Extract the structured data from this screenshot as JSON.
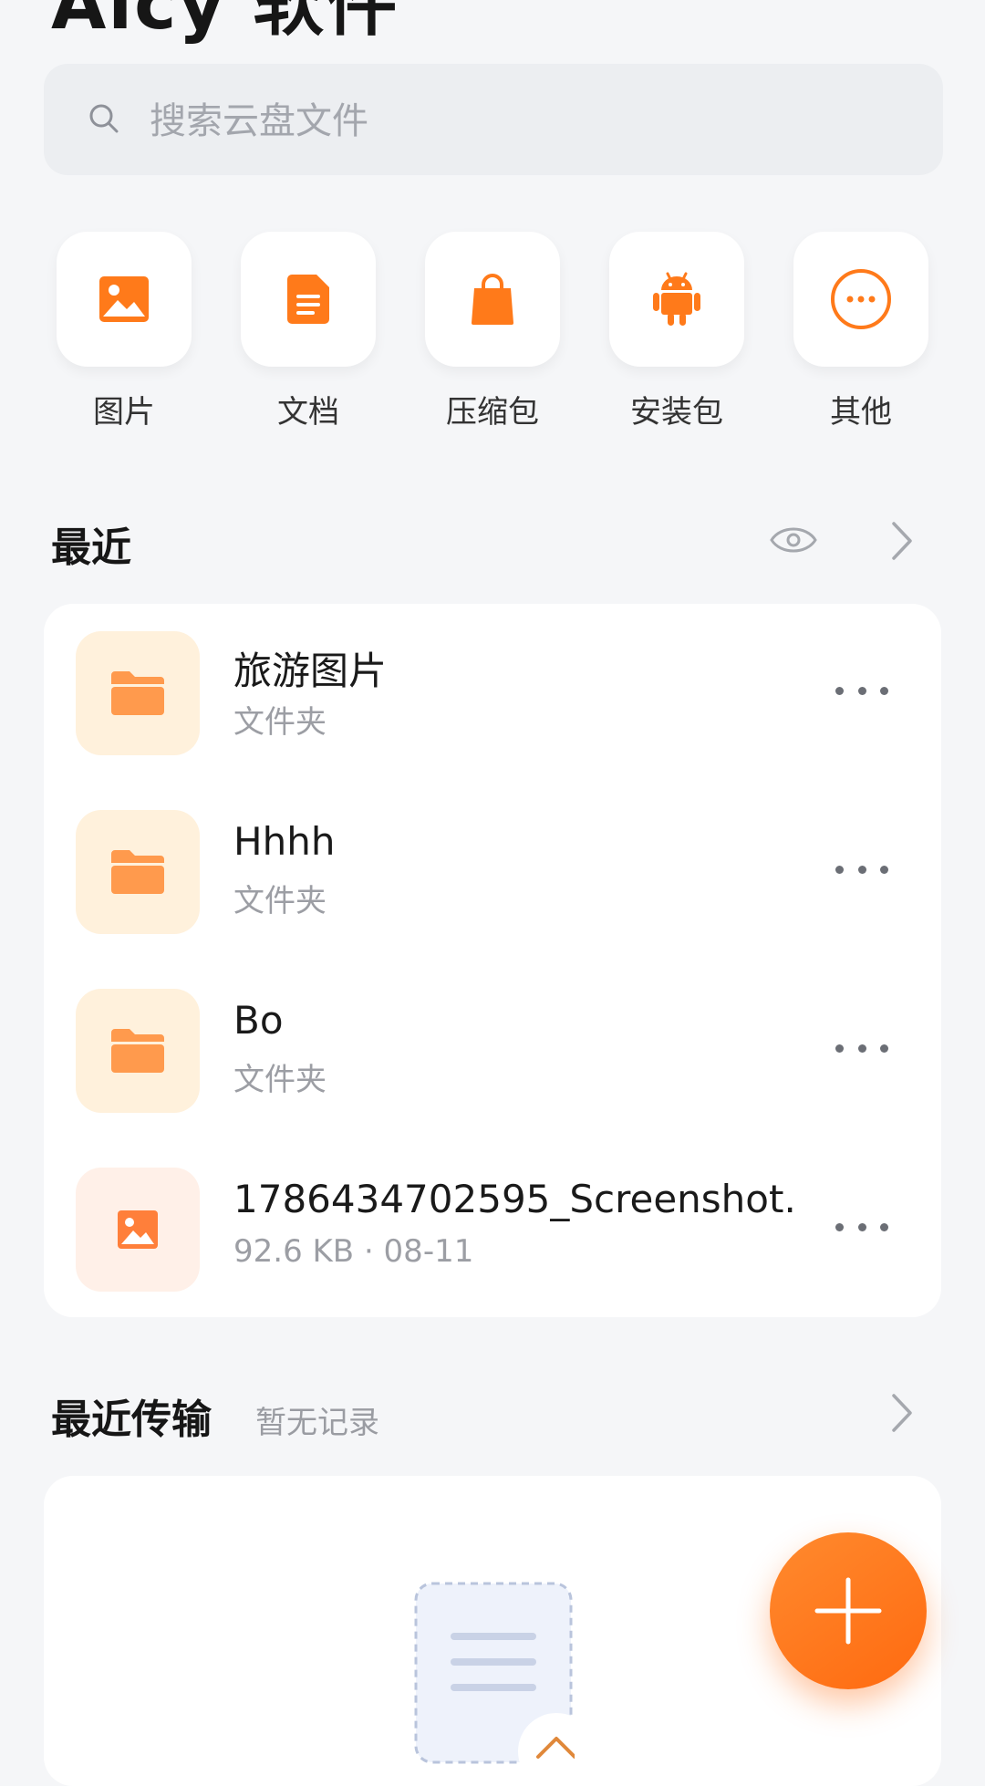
{
  "app": {
    "title": "Aicy 软件"
  },
  "search": {
    "placeholder": "搜索云盘文件",
    "icon": "search-icon"
  },
  "categories": [
    {
      "label": "图片",
      "icon": "image-icon"
    },
    {
      "label": "文档",
      "icon": "document-icon"
    },
    {
      "label": "压缩包",
      "icon": "shopping-bag-icon"
    },
    {
      "label": "安装包",
      "icon": "android-icon"
    },
    {
      "label": "其他",
      "icon": "more-circle-icon"
    }
  ],
  "recent": {
    "title": "最近",
    "items": [
      {
        "name": "旅游图片",
        "meta": "文件夹",
        "type": "folder"
      },
      {
        "name": "Hhhh",
        "meta": "文件夹",
        "type": "folder"
      },
      {
        "name": "Bo",
        "meta": "文件夹",
        "type": "folder"
      },
      {
        "name": "1786434702595_Screenshot...",
        "meta": "92.6 KB · 08-11",
        "type": "image"
      }
    ]
  },
  "transfers": {
    "title": "最近传输",
    "subtitle": "暂无记录"
  },
  "colors": {
    "accent": "#ff7a1a",
    "folder_bg": "#fff1dc",
    "folder_icon": "#ff9a4d",
    "background": "#f5f6f8"
  }
}
